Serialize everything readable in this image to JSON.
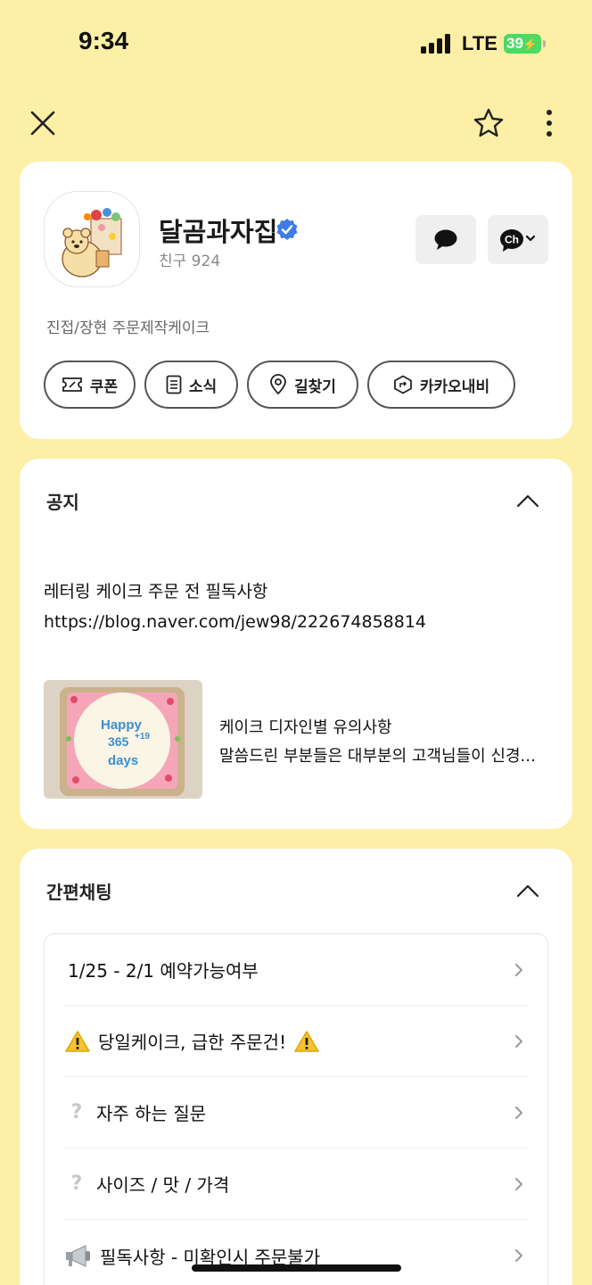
{
  "status_bar": {
    "time": "9:34",
    "network": "LTE",
    "battery": "39"
  },
  "nav": {
    "close_icon": "close-icon",
    "star_icon": "star-icon",
    "more_icon": "more-vertical-icon"
  },
  "profile": {
    "name": "달곰과자집",
    "friends": "친구 924",
    "description": "진접/장현 주문제작케이크",
    "chat_icon": "chat-bubble-icon",
    "channel_icon": "Ch",
    "pills": [
      {
        "label": "쿠폰",
        "icon": "coupon-icon"
      },
      {
        "label": "소식",
        "icon": "document-icon"
      },
      {
        "label": "길찾기",
        "icon": "map-pin-icon"
      },
      {
        "label": "카카오내비",
        "icon": "navi-icon"
      }
    ]
  },
  "notice": {
    "title": "공지",
    "text_line1": "레터링 케이크 주문 전 필독사항",
    "text_line2": "https://blog.naver.com/jew98/222674858814",
    "post_title": "케이크 디자인별 유의사항",
    "post_excerpt": "말씀드린 부분들은 대부분의 고객님들이 신경...",
    "thumb_text": {
      "line1": "Happy",
      "line2": "365",
      "sup": "+19",
      "line3": "days"
    }
  },
  "quick_chat": {
    "title": "간편채팅",
    "items": [
      {
        "label": "1/25 - 2/1 예약가능여부"
      },
      {
        "label": "당일케이크, 급한 주문건!"
      },
      {
        "label": "자주 하는 질문"
      },
      {
        "label": "사이즈 / 맛 / 가격"
      },
      {
        "label": "필독사항 - 미확인시 주문불가"
      }
    ]
  },
  "colors": {
    "background": "#fdefa6",
    "verified": "#3d7be6",
    "battery": "#4cd964"
  }
}
